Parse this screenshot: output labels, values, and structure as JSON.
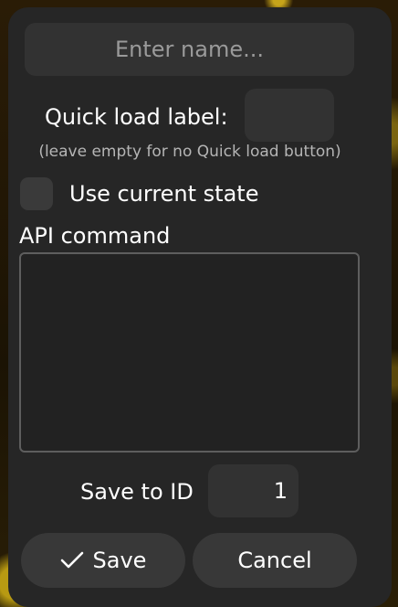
{
  "form": {
    "name_placeholder": "Enter name...",
    "name_value": "",
    "quick_load_label": "Quick load label:",
    "quick_load_value": "",
    "quick_load_hint": "(leave empty for no Quick load button)",
    "use_current_state_label": "Use current state",
    "use_current_state_checked": false,
    "api_command_label": "API command",
    "api_command_value": "",
    "save_to_id_label": "Save to ID",
    "save_to_id_value": "1"
  },
  "buttons": {
    "save_label": "Save",
    "save_icon": "check-icon",
    "cancel_label": "Cancel"
  },
  "colors": {
    "dialog_background": "#262626",
    "input_background": "#323232",
    "button_background": "#383838",
    "text": "#ffffff",
    "placeholder": "#9a9a9a"
  }
}
